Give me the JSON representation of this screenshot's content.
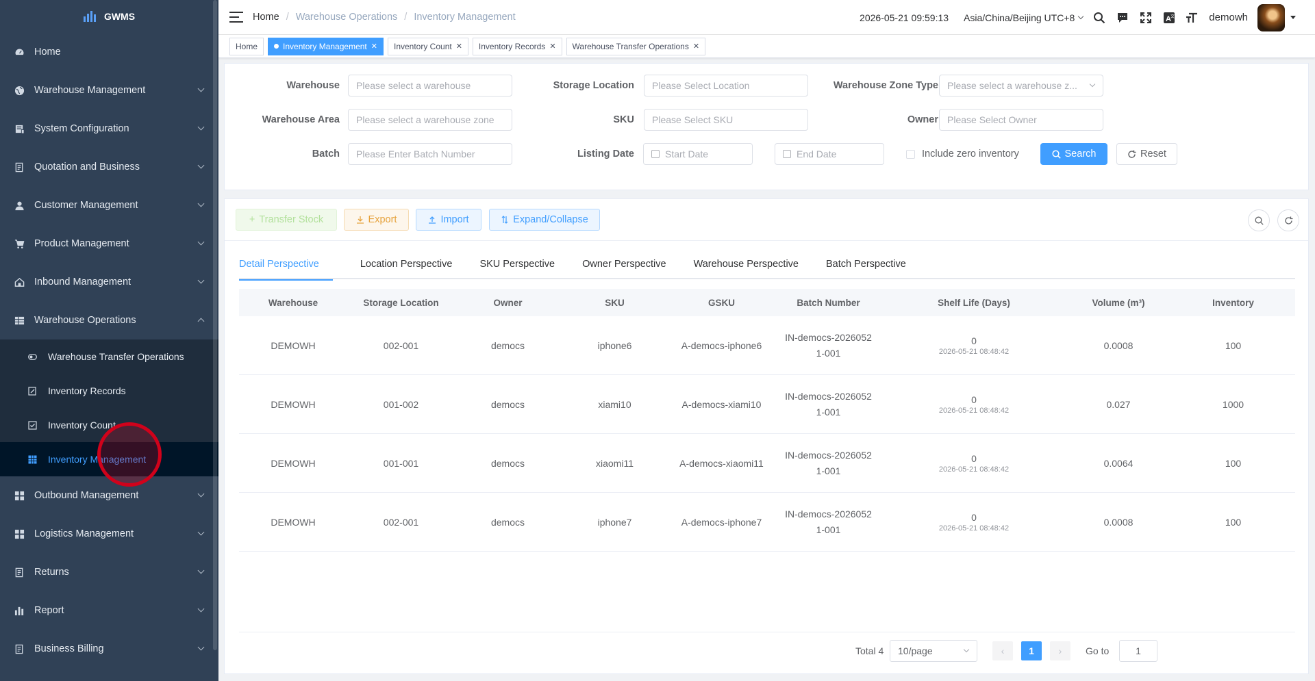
{
  "app": {
    "name": "GWMS"
  },
  "sidebar": {
    "items": [
      {
        "label": "Home",
        "icon": "dashboard-icon"
      },
      {
        "label": "Warehouse Management",
        "icon": "globe-icon"
      },
      {
        "label": "System Configuration",
        "icon": "server-icon"
      },
      {
        "label": "Quotation and Business",
        "icon": "document-icon"
      },
      {
        "label": "Customer Management",
        "icon": "user-icon"
      },
      {
        "label": "Product Management",
        "icon": "cart-icon"
      },
      {
        "label": "Inbound Management",
        "icon": "house-icon"
      },
      {
        "label": "Warehouse Operations",
        "icon": "table-icon"
      }
    ],
    "subitems": [
      {
        "label": "Warehouse Transfer Operations",
        "icon": "toggle-icon"
      },
      {
        "label": "Inventory Records",
        "icon": "edit-icon"
      },
      {
        "label": "Inventory Count",
        "icon": "checkbox-icon"
      },
      {
        "label": "Inventory Management",
        "icon": "grid-icon"
      }
    ],
    "items_after": [
      {
        "label": "Outbound Management",
        "icon": "apps-icon"
      },
      {
        "label": "Logistics Management",
        "icon": "apps-icon"
      },
      {
        "label": "Returns",
        "icon": "document-icon"
      },
      {
        "label": "Report",
        "icon": "bar-chart-icon"
      },
      {
        "label": "Business Billing",
        "icon": "document-icon"
      }
    ]
  },
  "header": {
    "breadcrumb": [
      "Home",
      "Warehouse Operations",
      "Inventory Management"
    ],
    "datetime": "2026-05-21 09:59:13",
    "timezone": "Asia/China/Beijing UTC+8",
    "username": "demowh"
  },
  "tags": [
    {
      "label": "Home"
    },
    {
      "label": "Inventory Management",
      "active": true
    },
    {
      "label": "Inventory Count"
    },
    {
      "label": "Inventory Records"
    },
    {
      "label": "Warehouse Transfer Operations"
    }
  ],
  "filter": {
    "warehouse": {
      "label": "Warehouse",
      "placeholder": "Please select a warehouse"
    },
    "location": {
      "label": "Storage Location",
      "placeholder": "Please Select Location"
    },
    "zone_type": {
      "label": "Warehouse Zone Type",
      "placeholder": "Please select a warehouse z..."
    },
    "area": {
      "label": "Warehouse Area",
      "placeholder": "Please select a warehouse zone"
    },
    "sku": {
      "label": "SKU",
      "placeholder": "Please Select SKU"
    },
    "owner": {
      "label": "Owner",
      "placeholder": "Please Select Owner"
    },
    "batch": {
      "label": "Batch",
      "placeholder": "Please Enter Batch Number"
    },
    "listing_date": {
      "label": "Listing Date",
      "start_placeholder": "Start Date",
      "end_placeholder": "End Date"
    },
    "include_zero": "Include zero inventory",
    "search_label": "Search",
    "reset_label": "Reset"
  },
  "toolbar": {
    "transfer": "Transfer Stock",
    "export": "Export",
    "import": "Import",
    "expand": "Expand/Collapse"
  },
  "tabs": [
    {
      "label": "Detail Perspective",
      "active": true
    },
    {
      "label": "Location Perspective"
    },
    {
      "label": "SKU Perspective"
    },
    {
      "label": "Owner Perspective"
    },
    {
      "label": "Warehouse Perspective"
    },
    {
      "label": "Batch Perspective"
    }
  ],
  "table": {
    "columns": [
      "Warehouse",
      "Storage Location",
      "Owner",
      "SKU",
      "GSKU",
      "Batch Number",
      "Shelf Life (Days)",
      "Volume (m³)",
      "Inventory"
    ],
    "rows": [
      {
        "warehouse": "DEMOWH",
        "location": "002-001",
        "owner": "democs",
        "sku": "iphone6",
        "gsku": "A-democs-iphone6",
        "batch": "IN-democs-20260521-001",
        "shelf_days": "0",
        "shelf_date": "2026-05-21 08:48:42",
        "volume": "0.0008",
        "inventory": "100"
      },
      {
        "warehouse": "DEMOWH",
        "location": "001-002",
        "owner": "democs",
        "sku": "xiami10",
        "gsku": "A-democs-xiami10",
        "batch": "IN-democs-20260521-001",
        "shelf_days": "0",
        "shelf_date": "2026-05-21 08:48:42",
        "volume": "0.027",
        "inventory": "1000"
      },
      {
        "warehouse": "DEMOWH",
        "location": "001-001",
        "owner": "democs",
        "sku": "xiaomi11",
        "gsku": "A-democs-xiaomi11",
        "batch": "IN-democs-20260521-001",
        "shelf_days": "0",
        "shelf_date": "2026-05-21 08:48:42",
        "volume": "0.0064",
        "inventory": "100"
      },
      {
        "warehouse": "DEMOWH",
        "location": "002-001",
        "owner": "democs",
        "sku": "iphone7",
        "gsku": "A-democs-iphone7",
        "batch": "IN-democs-20260521-001",
        "shelf_days": "0",
        "shelf_date": "2026-05-21 08:48:42",
        "volume": "0.0008",
        "inventory": "100"
      }
    ]
  },
  "pagination": {
    "total": "Total 4",
    "page_size": "10/page",
    "current": "1",
    "goto_label": "Go to",
    "goto_value": "1"
  },
  "colors": {
    "primary": "#409eff",
    "sidebar_bg": "#304156",
    "submenu_bg": "#1f2d3d"
  }
}
